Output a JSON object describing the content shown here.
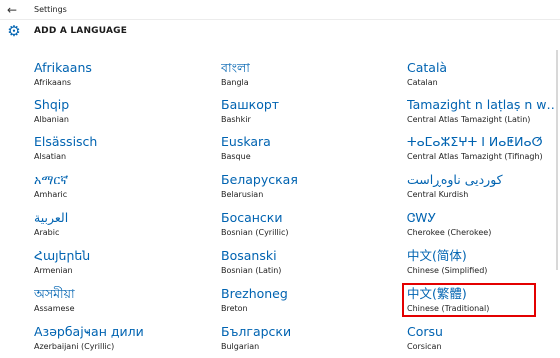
{
  "window": {
    "title": "Settings",
    "back_icon": "back-arrow-icon"
  },
  "header": {
    "title": "ADD A LANGUAGE",
    "icon": "gear-icon",
    "accent_color": "#0063b1"
  },
  "languages": {
    "columns": [
      [
        {
          "native": "Afrikaans",
          "english": "Afrikaans"
        },
        {
          "native": "Shqip",
          "english": "Albanian"
        },
        {
          "native": "Elsässisch",
          "english": "Alsatian"
        },
        {
          "native": "አማርኛ",
          "english": "Amharic"
        },
        {
          "native": "العربية",
          "english": "Arabic"
        },
        {
          "native": "Հայերեն",
          "english": "Armenian"
        },
        {
          "native": "অসমীয়া",
          "english": "Assamese"
        },
        {
          "native": "Азәрбајҹан дили",
          "english": "Azerbaijani (Cyrillic)"
        }
      ],
      [
        {
          "native": "বাংলা",
          "english": "Bangla"
        },
        {
          "native": "Башкорт",
          "english": "Bashkir"
        },
        {
          "native": "Euskara",
          "english": "Basque"
        },
        {
          "native": "Беларуская",
          "english": "Belarusian"
        },
        {
          "native": "Босански",
          "english": "Bosnian (Cyrillic)"
        },
        {
          "native": "Bosanski",
          "english": "Bosnian (Latin)"
        },
        {
          "native": "Brezhoneg",
          "english": "Breton"
        },
        {
          "native": "Български",
          "english": "Bulgarian"
        }
      ],
      [
        {
          "native": "Català",
          "english": "Catalan"
        },
        {
          "native": "Tamazight n laṭlaṣ n wamm...",
          "english": "Central Atlas Tamazight (Latin)"
        },
        {
          "native": "ⵜⴰⵎⴰⵣⵉⵖⵜ ⵏ ⵍⴰⵟⵍⴰⵚ",
          "english": "Central Atlas Tamazight (Tifinagh)"
        },
        {
          "native": "کوردیی ناوەڕاست",
          "english": "Central Kurdish"
        },
        {
          "native": "ᏣᎳᎩ",
          "english": "Cherokee (Cherokee)"
        },
        {
          "native": "中文(简体)",
          "english": "Chinese (Simplified)"
        },
        {
          "native": "中文(繁體)",
          "english": "Chinese (Traditional)"
        },
        {
          "native": "Corsu",
          "english": "Corsican"
        }
      ]
    ],
    "selected": "Chinese (Traditional)",
    "highlight_color": "#e30000"
  }
}
